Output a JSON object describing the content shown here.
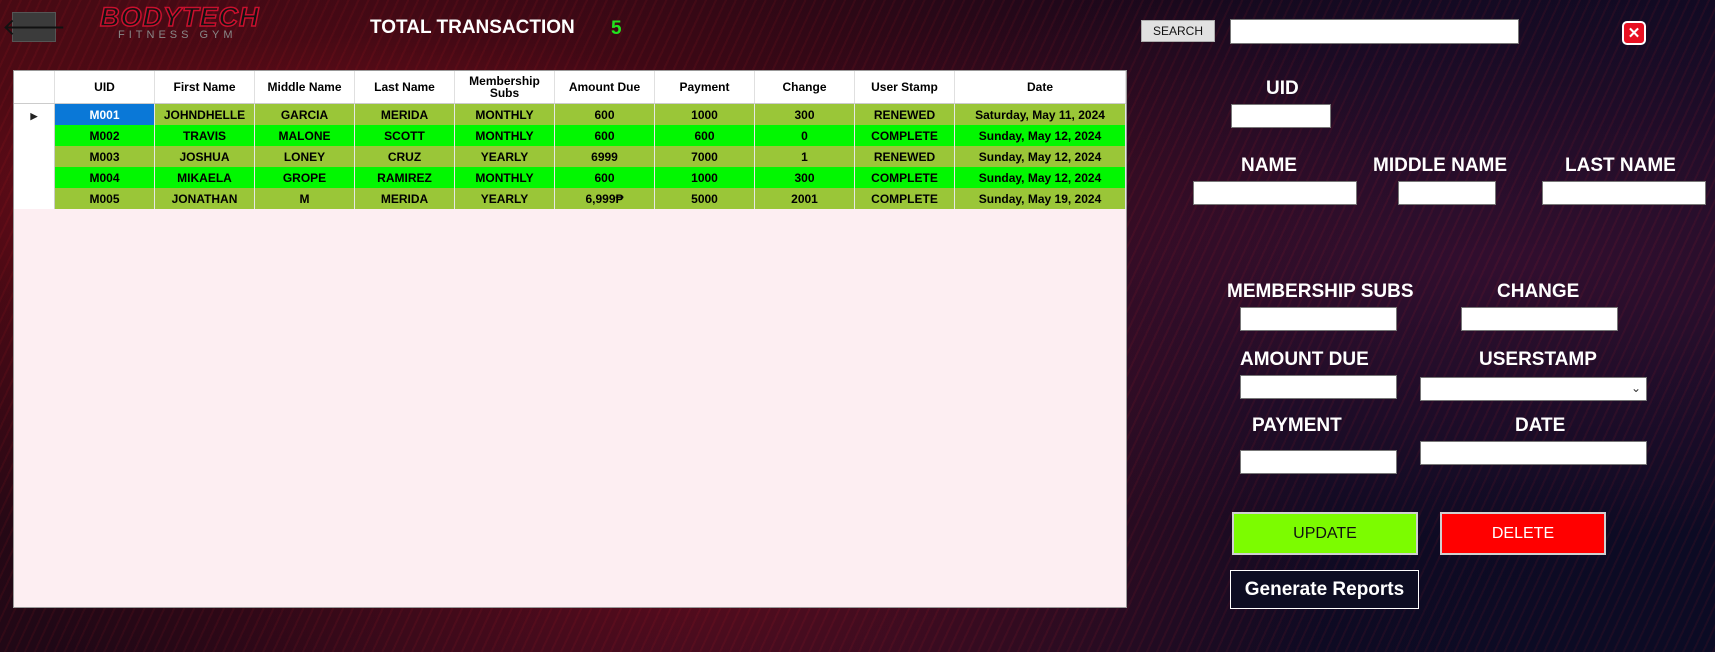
{
  "header": {
    "back_glyph": "🡐",
    "logo": {
      "top": "BODYTECH",
      "sub": "FITNESS GYM"
    },
    "total_label": "TOTAL TRANSACTION",
    "total_value": "5"
  },
  "search": {
    "button_label": "SEARCH",
    "value": ""
  },
  "close_glyph": "✕",
  "grid": {
    "columns": [
      "UID",
      "First Name",
      "Middle Name",
      "Last Name",
      "Membership Subs",
      "Amount Due",
      "Payment",
      "Change",
      "User Stamp",
      "Date"
    ],
    "rows": [
      [
        "M001",
        "JOHNDHELLE",
        "GARCIA",
        "MERIDA",
        "MONTHLY",
        "600",
        "1000",
        "300",
        "RENEWED",
        "Saturday, May 11, 2024"
      ],
      [
        "M002",
        "TRAVIS",
        "MALONE",
        "SCOTT",
        "MONTHLY",
        "600",
        "600",
        "0",
        "COMPLETE",
        "Sunday, May 12, 2024"
      ],
      [
        "M003",
        "JOSHUA",
        "LONEY",
        "CRUZ",
        "YEARLY",
        "6999",
        "7000",
        "1",
        "RENEWED",
        "Sunday, May 12, 2024"
      ],
      [
        "M004",
        "MIKAELA",
        "GROPE",
        "RAMIREZ",
        "MONTHLY",
        "600",
        "1000",
        "300",
        "COMPLETE",
        "Sunday, May 12, 2024"
      ],
      [
        "M005",
        "JONATHAN",
        "M",
        "MERIDA",
        "YEARLY",
        "6,999₱",
        "5000",
        "2001",
        "COMPLETE",
        "Sunday, May 19, 2024"
      ]
    ],
    "selected_row": 0,
    "row_indicator": "▶"
  },
  "form": {
    "uid_label": "UID",
    "name_label": "NAME",
    "middle_name_label": "MIDDLE NAME",
    "last_name_label": "LAST NAME",
    "membership_label": "MEMBERSHIP SUBS",
    "change_label": "CHANGE",
    "amount_due_label": "AMOUNT DUE",
    "userstamp_label": "USERSTAMP",
    "payment_label": "PAYMENT",
    "date_label": "DATE",
    "userstamp_value": "",
    "dropdown_chevron": "⌄"
  },
  "buttons": {
    "update": "UPDATE",
    "delete": "DELETE",
    "generate_reports": "Generate Reports"
  },
  "colors": {
    "accent_green": "#22e31f",
    "row_olive": "#9ac638",
    "row_green": "#02f701",
    "update_bg": "#7cfc00",
    "delete_bg": "#ff0000",
    "selected_cell": "#0a78d7"
  }
}
